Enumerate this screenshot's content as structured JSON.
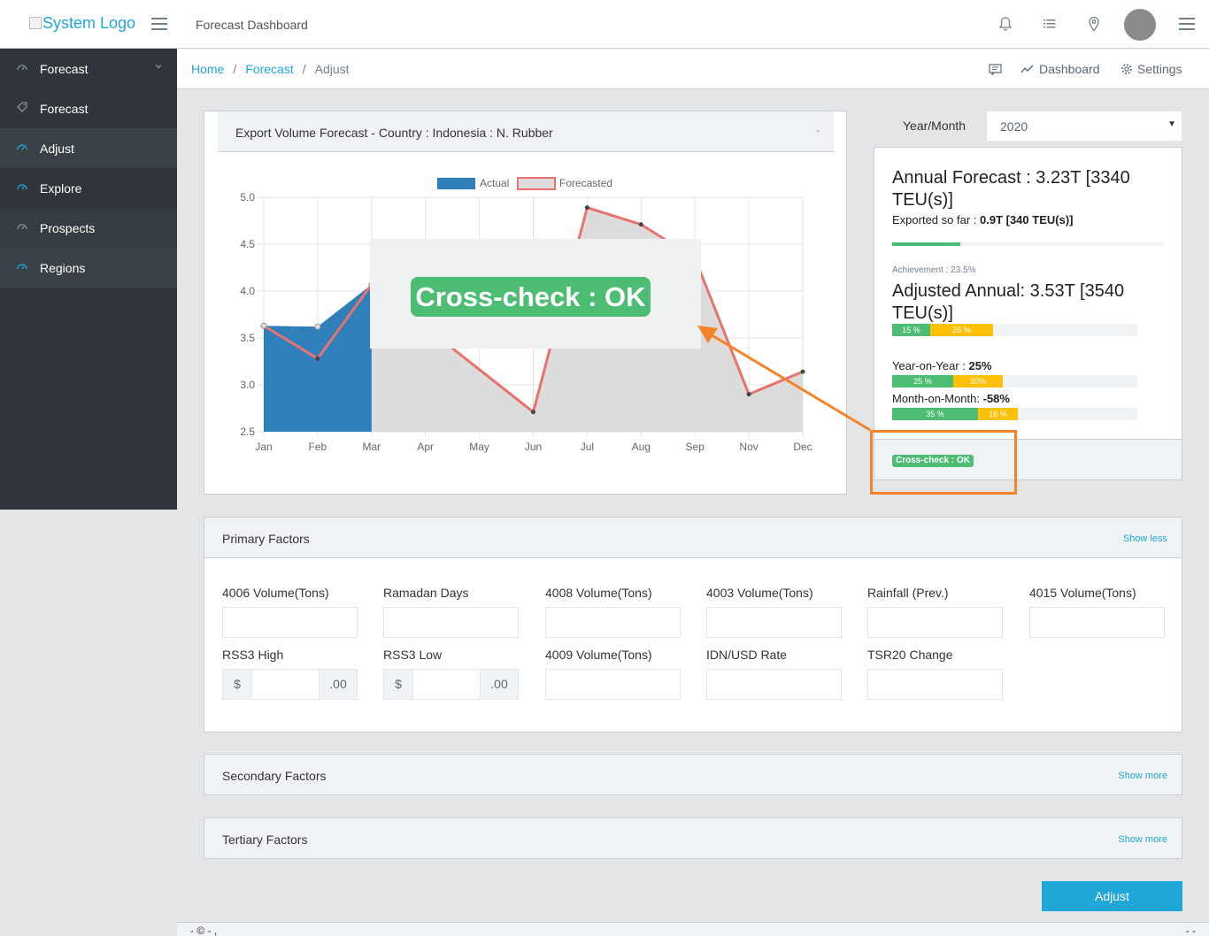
{
  "topbar": {
    "logo_alt": "System Logo",
    "title": "Forecast Dashboard",
    "icons": [
      "bell-icon",
      "list-icon",
      "location-pin-icon",
      "avatar",
      "menu-icon"
    ]
  },
  "sidebar": {
    "items": [
      {
        "label": "Forecast",
        "icon": "gauge-icon",
        "has_chevron": true
      },
      {
        "label": "Forecast",
        "icon": "tag-icon"
      },
      {
        "label": "Adjust",
        "icon": "gauge-icon",
        "active": true
      },
      {
        "label": "Explore",
        "icon": "gauge-icon"
      },
      {
        "label": "Prospects",
        "icon": "gauge-icon"
      },
      {
        "label": "Regions",
        "icon": "gauge-icon"
      }
    ]
  },
  "breadcrumb": {
    "home": "Home",
    "forecast": "Forecast",
    "current": "Adjust",
    "sep": "/",
    "right": {
      "dashboard": "Dashboard",
      "settings": "Settings"
    }
  },
  "chart_card": {
    "title": "Export Volume Forecast - Country : Indonesia : N. Rubber",
    "minimize": "-"
  },
  "chart_data": {
    "type": "line",
    "categories": [
      "Jan",
      "Feb",
      "Mar",
      "Apr",
      "May",
      "Jun",
      "Jul",
      "Aug",
      "Sep",
      "Nov",
      "Dec"
    ],
    "series": [
      {
        "name": "Actual",
        "style": "area",
        "values": [
          3.63,
          3.62,
          4.07,
          null,
          null,
          null,
          null,
          null,
          null,
          null,
          null
        ],
        "color": "#2f7fbb"
      },
      {
        "name": "Forecasted",
        "style": "area-line",
        "values": [
          3.63,
          3.28,
          4.07,
          null,
          null,
          2.71,
          4.89,
          4.71,
          4.35,
          2.9,
          3.14
        ],
        "color": "#e8736e"
      }
    ],
    "yticks": [
      "2.5",
      "3.0",
      "3.5",
      "4.0",
      "4.5",
      "5.0"
    ],
    "ylim": [
      2.5,
      5.0
    ],
    "grid": true,
    "legend": "top"
  },
  "overlay": {
    "badge": "Cross-check : OK"
  },
  "year_month": {
    "label": "Year/Month",
    "value": "2020"
  },
  "summary": {
    "annual_forecast_line1": "Annual Forecast : 3.23T [3340",
    "annual_forecast_line2": "TEU(s)]",
    "exported_label": "Exported so far : ",
    "exported_value": "0.9T [340 TEU(s)]",
    "progress": 0.25,
    "achievement_label": "Achievement : ",
    "achievement_value": "23.5%",
    "adjusted_line1": "Adjusted Annual: 3.53T [3540",
    "adjusted_line2": "TEU(s)]",
    "adjusted_bar": {
      "green": "15 %",
      "yellow": "26 %"
    },
    "yoy_label": "Year-on-Year : ",
    "yoy_value": "25%",
    "yoy_bar": {
      "green": "25 %",
      "yellow": "20%"
    },
    "mom_label": "Month-on-Month: ",
    "mom_value": "-58%",
    "mom_bar": {
      "green": "35 %",
      "yellow": "16 %"
    },
    "badge": "Cross-check : OK"
  },
  "colors": {
    "accent": "#20a8d8",
    "success": "#4dbd74",
    "warning": "#ffc107",
    "callout": "#f6822a",
    "sidebar": "#2f353a"
  },
  "primary": {
    "title": "Primary Factors",
    "toggle": "Show less",
    "fields": [
      {
        "label": "4006 Volume(Tons)"
      },
      {
        "label": "Ramadan Days"
      },
      {
        "label": "4008 Volume(Tons)"
      },
      {
        "label": "4003 Volume(Tons)"
      },
      {
        "label": "Rainfall (Prev.)"
      },
      {
        "label": "4015 Volume(Tons)"
      },
      {
        "label": "RSS3 High",
        "prefix": "$",
        "suffix": ".00"
      },
      {
        "label": "RSS3 Low",
        "prefix": "$",
        "suffix": ".00"
      },
      {
        "label": "4009 Volume(Tons)"
      },
      {
        "label": "IDN/USD Rate"
      },
      {
        "label": "TSR20 Change"
      }
    ]
  },
  "secondary": {
    "title": "Secondary Factors",
    "toggle": "Show more"
  },
  "tertiary": {
    "title": "Tertiary Factors",
    "toggle": "Show more"
  },
  "actions": {
    "adjust": "Adjust"
  },
  "footer": {
    "text": "- © - ,",
    "right": "- -"
  }
}
